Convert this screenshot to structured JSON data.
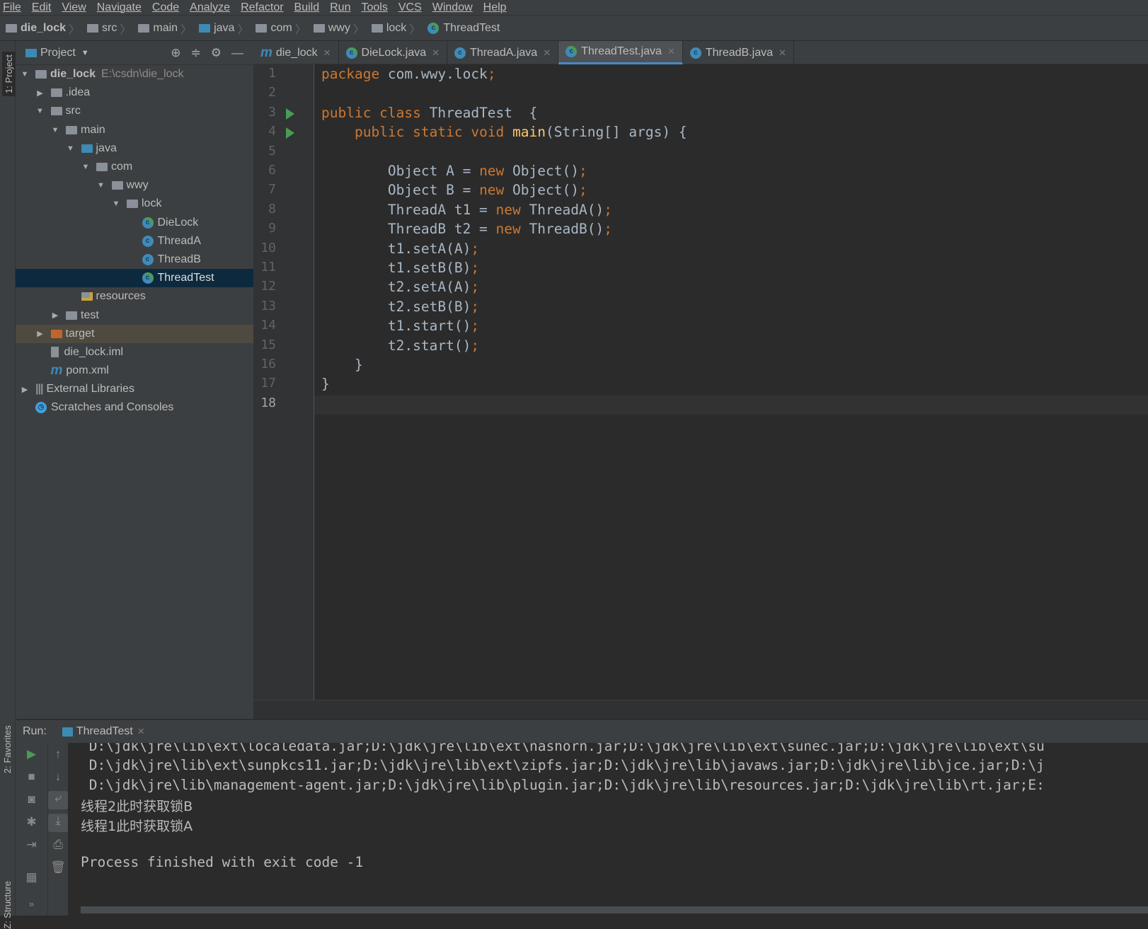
{
  "menu": [
    "File",
    "Edit",
    "View",
    "Navigate",
    "Code",
    "Analyze",
    "Refactor",
    "Build",
    "Run",
    "Tools",
    "VCS",
    "Window",
    "Help"
  ],
  "breadcrumb": [
    "die_lock",
    "src",
    "main",
    "java",
    "com",
    "wwy",
    "lock",
    "ThreadTest"
  ],
  "left_stripe": {
    "project": "1: Project",
    "favorites": "2: Favorites",
    "structure": "Z: Structure"
  },
  "project": {
    "title": "Project",
    "tree": [
      {
        "label": "die_lock",
        "path": "E:\\csdn\\die_lock",
        "depth": 0,
        "arrow": "down",
        "icon": "module-icon"
      },
      {
        "label": ".idea",
        "depth": 1,
        "arrow": "right",
        "icon": "folder-icon"
      },
      {
        "label": "src",
        "depth": 1,
        "arrow": "down",
        "icon": "folder-icon"
      },
      {
        "label": "main",
        "depth": 2,
        "arrow": "down",
        "icon": "folder-icon"
      },
      {
        "label": "java",
        "depth": 3,
        "arrow": "down",
        "icon": "source-folder-icon"
      },
      {
        "label": "com",
        "depth": 4,
        "arrow": "down",
        "icon": "package-icon"
      },
      {
        "label": "wwy",
        "depth": 5,
        "arrow": "down",
        "icon": "package-icon"
      },
      {
        "label": "lock",
        "depth": 6,
        "arrow": "down",
        "icon": "package-icon"
      },
      {
        "label": "DieLock",
        "depth": 7,
        "arrow": "",
        "icon": "runnable-class-icon"
      },
      {
        "label": "ThreadA",
        "depth": 7,
        "arrow": "",
        "icon": "class-icon"
      },
      {
        "label": "ThreadB",
        "depth": 7,
        "arrow": "",
        "icon": "class-icon"
      },
      {
        "label": "ThreadTest",
        "depth": 7,
        "arrow": "",
        "icon": "runnable-class-icon",
        "selected": true
      },
      {
        "label": "resources",
        "depth": 3,
        "arrow": "",
        "icon": "resources-folder-icon"
      },
      {
        "label": "test",
        "depth": 2,
        "arrow": "right",
        "icon": "folder-icon"
      },
      {
        "label": "target",
        "depth": 1,
        "arrow": "right",
        "icon": "excluded-folder-icon",
        "highlight": true
      },
      {
        "label": "die_lock.iml",
        "depth": 1,
        "arrow": "",
        "icon": "iml-file-icon"
      },
      {
        "label": "pom.xml",
        "depth": 1,
        "arrow": "",
        "icon": "maven-icon"
      },
      {
        "label": "External Libraries",
        "depth": 0,
        "arrow": "right",
        "icon": "libraries-icon"
      },
      {
        "label": "Scratches and Consoles",
        "depth": 0,
        "arrow": "",
        "icon": "scratches-icon"
      }
    ]
  },
  "tabs": [
    {
      "label": "die_lock",
      "icon": "maven-icon"
    },
    {
      "label": "DieLock.java",
      "icon": "runnable-class-icon"
    },
    {
      "label": "ThreadA.java",
      "icon": "class-icon"
    },
    {
      "label": "ThreadTest.java",
      "icon": "runnable-class-icon",
      "active": true
    },
    {
      "label": "ThreadB.java",
      "icon": "class-icon"
    }
  ],
  "editor": {
    "current_line": 18,
    "lines": [
      [
        [
          "kw",
          "package "
        ],
        [
          "",
          "com.wwy.lock"
        ],
        [
          "kw",
          ";"
        ]
      ],
      [],
      [
        [
          "kw",
          "public class "
        ],
        [
          "",
          "ThreadTest  {"
        ]
      ],
      [
        [
          "",
          "    "
        ],
        [
          "kw",
          "public static void "
        ],
        [
          "fn",
          "main"
        ],
        [
          "",
          "(String[] args) {"
        ]
      ],
      [],
      [
        [
          "",
          "        Object A = "
        ],
        [
          "kw",
          "new "
        ],
        [
          "",
          "Object()"
        ],
        [
          "kw",
          ";"
        ]
      ],
      [
        [
          "",
          "        Object B = "
        ],
        [
          "kw",
          "new "
        ],
        [
          "",
          "Object()"
        ],
        [
          "kw",
          ";"
        ]
      ],
      [
        [
          "",
          "        ThreadA t1 = "
        ],
        [
          "kw",
          "new "
        ],
        [
          "",
          "ThreadA()"
        ],
        [
          "kw",
          ";"
        ]
      ],
      [
        [
          "",
          "        ThreadB t2 = "
        ],
        [
          "kw",
          "new "
        ],
        [
          "",
          "ThreadB()"
        ],
        [
          "kw",
          ";"
        ]
      ],
      [
        [
          "",
          "        t1.setA(A)"
        ],
        [
          "kw",
          ";"
        ]
      ],
      [
        [
          "",
          "        t1.setB(B)"
        ],
        [
          "kw",
          ";"
        ]
      ],
      [
        [
          "",
          "        t2.setA(A)"
        ],
        [
          "kw",
          ";"
        ]
      ],
      [
        [
          "",
          "        t2.setB(B)"
        ],
        [
          "kw",
          ";"
        ]
      ],
      [
        [
          "",
          "        t1.start()"
        ],
        [
          "kw",
          ";"
        ]
      ],
      [
        [
          "",
          "        t2.start()"
        ],
        [
          "kw",
          ";"
        ]
      ],
      [
        [
          "",
          "    }"
        ]
      ],
      [
        [
          "",
          "}"
        ]
      ],
      []
    ],
    "run_markers": [
      3,
      4
    ]
  },
  "run": {
    "label": "Run:",
    "tab": "ThreadTest",
    "output": [
      " D:\\jdk\\jre\\lib\\ext\\localedata.jar;D:\\jdk\\jre\\lib\\ext\\nashorn.jar;D:\\jdk\\jre\\lib\\ext\\sunec.jar;D:\\jdk\\jre\\lib\\ext\\su",
      " D:\\jdk\\jre\\lib\\ext\\sunpkcs11.jar;D:\\jdk\\jre\\lib\\ext\\zipfs.jar;D:\\jdk\\jre\\lib\\javaws.jar;D:\\jdk\\jre\\lib\\jce.jar;D:\\j",
      " D:\\jdk\\jre\\lib\\management-agent.jar;D:\\jdk\\jre\\lib\\plugin.jar;D:\\jdk\\jre\\lib\\resources.jar;D:\\jdk\\jre\\lib\\rt.jar;E:",
      "线程2此时获取锁B",
      "线程1此时获取锁A",
      "",
      "Process finished with exit code -1"
    ]
  },
  "colors": {
    "keyword": "#cc7832",
    "function": "#ffc66d",
    "text": "#a9b7c6",
    "run_marker": "#499c54",
    "selection": "#0d293e",
    "tab_accent": "#4a88c7"
  }
}
